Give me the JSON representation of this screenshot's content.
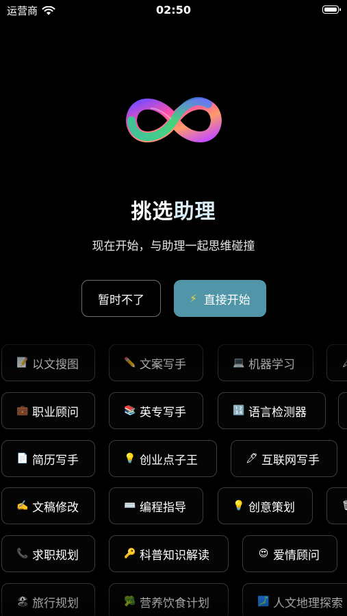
{
  "status_bar": {
    "carrier": "运营商",
    "time": "02:50"
  },
  "header": {
    "title_part1": "挑选",
    "title_part2": "助理",
    "subtitle": "现在开始，与助理一起思维碰撞"
  },
  "actions": {
    "skip_label": "暂时不了",
    "start_label": "直接开始",
    "start_icon": "⚡"
  },
  "chips": [
    [
      {
        "icon": "📝",
        "label": "以文搜图"
      },
      {
        "icon": "✏️",
        "label": "文案写手"
      },
      {
        "icon": "💻",
        "label": "机器学习"
      },
      {
        "icon": "🖋",
        "label": ""
      }
    ],
    [
      {
        "icon": "💼",
        "label": "职业顾问"
      },
      {
        "icon": "📚",
        "label": "英专写手"
      },
      {
        "icon": "🔢",
        "label": "语言检测器"
      },
      {
        "icon": "",
        "label": ""
      }
    ],
    [
      {
        "icon": "📄",
        "label": "简历写手"
      },
      {
        "icon": "💡",
        "label": "创业点子王"
      },
      {
        "icon": "🖊",
        "label": "互联网写手"
      }
    ],
    [
      {
        "icon": "✍️",
        "label": "文稿修改"
      },
      {
        "icon": "⌨️",
        "label": "编程指导"
      },
      {
        "icon": "💡",
        "label": "创意策划"
      },
      {
        "icon": "🗑",
        "label": ""
      }
    ],
    [
      {
        "icon": "📞",
        "label": "求职规划"
      },
      {
        "icon": "🔑",
        "label": "科普知识解读"
      },
      {
        "icon": "😍",
        "label": "爱情顾问"
      }
    ],
    [
      {
        "icon": "🏖",
        "label": "旅行规划"
      },
      {
        "icon": "🥦",
        "label": "营养饮食计划"
      },
      {
        "icon": "🗾",
        "label": "人文地理探索"
      }
    ]
  ],
  "colors": {
    "accent": "#5096a8",
    "bolt": "#ffd43b",
    "background": "#000000"
  }
}
